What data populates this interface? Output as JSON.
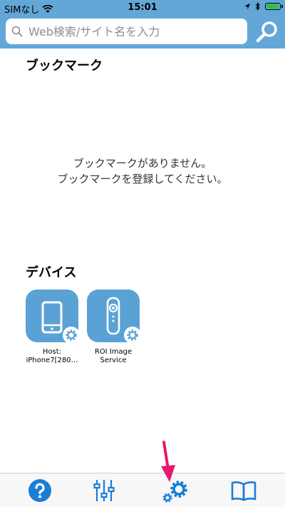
{
  "status_bar": {
    "carrier": "SIMなし",
    "time": "15:01",
    "battery_level": 0.9
  },
  "search": {
    "placeholder": "Web検索/サイト名を入力",
    "value": ""
  },
  "bookmarks": {
    "title": "ブックマーク",
    "empty_line1": "ブックマークがありません。",
    "empty_line2": "ブックマークを登録してください。"
  },
  "devices": {
    "title": "デバイス",
    "items": [
      {
        "label_line1": "Host:",
        "label_line2": "iPhone7[280…",
        "icon": "smartphone-icon"
      },
      {
        "label_line1": "ROI Image",
        "label_line2": "Service",
        "icon": "camera-device-icon"
      }
    ]
  },
  "tab_bar": {
    "items": [
      {
        "icon": "help-icon"
      },
      {
        "icon": "sliders-icon"
      },
      {
        "icon": "settings-gears-icon"
      },
      {
        "icon": "book-icon"
      }
    ]
  },
  "colors": {
    "header_blue": "#62a7d8",
    "device_blue": "#5aa2d6",
    "tab_icon_blue": "#1a7ed4",
    "battery_green": "#30c23a",
    "annotation_pink": "#e6196e"
  }
}
